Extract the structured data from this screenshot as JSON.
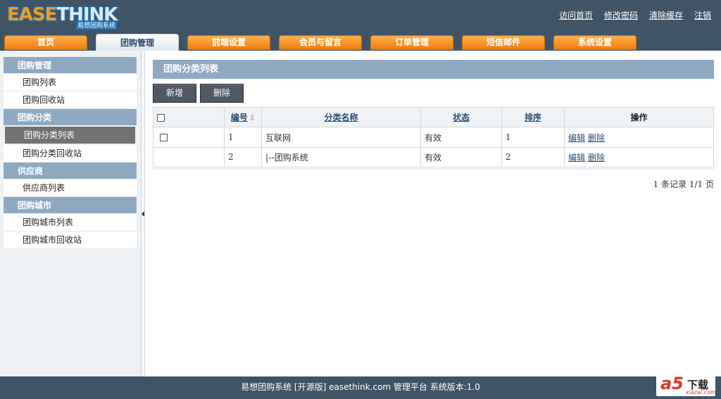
{
  "header": {
    "logo_text_a": "EASE",
    "logo_text_b": "THINK",
    "logo_sub": "易想团购系统",
    "links": [
      "访问首页",
      "修改密码",
      "清除缓存",
      "注销"
    ]
  },
  "nav": {
    "tabs": [
      "首页",
      "团购管理",
      "前端设置",
      "会员与留言",
      "订单管理",
      "短信邮件",
      "系统设置"
    ],
    "active": "团购管理"
  },
  "sidebar": {
    "groups": [
      {
        "title": "团购管理",
        "items": [
          "团购列表",
          "团购回收站"
        ]
      },
      {
        "title": "团购分类",
        "items": [
          "团购分类列表",
          "团购分类回收站"
        ]
      },
      {
        "title": "供应商",
        "items": [
          "供应商列表"
        ]
      },
      {
        "title": "团购城市",
        "items": [
          "团购城市列表",
          "团购城市回收站"
        ]
      }
    ],
    "active_item": "团购分类列表"
  },
  "main": {
    "title": "团购分类列表",
    "toolbar": {
      "add_label": "新增",
      "delete_label": "删除"
    },
    "table": {
      "headers": {
        "id": "编号",
        "name": "分类名称",
        "status": "状态",
        "sort": "排序",
        "ops": "操作"
      },
      "rows": [
        {
          "id": "1",
          "name": "互联网",
          "status": "有效",
          "sort": "1",
          "edit": "编辑",
          "delete": "删除",
          "has_checkbox": true
        },
        {
          "id": "2",
          "name": "|--团购系统",
          "status": "有效",
          "sort": "2",
          "edit": "编辑",
          "delete": "删除",
          "has_checkbox": false
        }
      ]
    },
    "pager": "1 条记录  1/1 页"
  },
  "footer": {
    "text": "易想团购系统  [开源版] easethink.com 管理平台  系统版本:1.0"
  },
  "watermark": {
    "mark": "a5",
    "title": "下载",
    "site": "xiazai.com"
  },
  "colors": {
    "header_bg": "#3f5466",
    "tab_orange": "#f07d10",
    "sidebar_title": "#8fa9c2",
    "link": "#2a4d73"
  },
  "icons": {
    "sort": "sort-down-icon",
    "collapse": "chevron-left-icon"
  }
}
